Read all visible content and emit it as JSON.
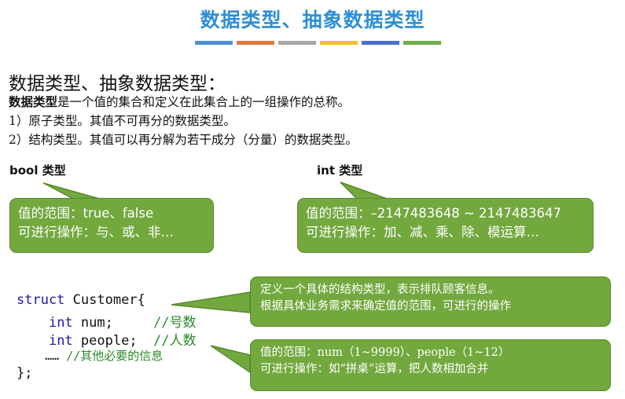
{
  "header": {
    "title": "数据类型、抽象数据类型",
    "bar_colors": [
      "#4e91d4",
      "#e07a3a",
      "#a6a6a6",
      "#f2c12e",
      "#4b6fc9",
      "#6fb04a"
    ]
  },
  "intro": {
    "heading": "数据类型、抽象数据类型：",
    "def_term": "数据类型",
    "def_text": "是一个值的集合和定义在此集合上的一组操作的总称。",
    "item1": "1）原子类型。其值不可再分的数据类型。",
    "item2": "2）结构类型。其值可以再分解为若干成分（分量）的数据类型。"
  },
  "bool_type": {
    "label": "bool 类型",
    "range": "值的范围：true、false",
    "ops": "可进行操作：与、或、非…"
  },
  "int_type": {
    "label": "int 类型",
    "range": "值的范围：–2147483648 ~ 2147483647",
    "ops": "可进行操作：加、减、乘、除、模运算…"
  },
  "code": {
    "kw_struct": "struct",
    "struct_name": " Customer{",
    "kw_int1": "int",
    "field1": " num;     ",
    "comment1": "//号数",
    "kw_int2": "int",
    "field2": " people;  ",
    "comment2": "//人数",
    "ellipsis": "……",
    "comment3": " //其他必要的信息",
    "closing": "};"
  },
  "callout_struct": {
    "line1": "定义一个具体的结构类型，表示排队顾客信息。",
    "line2": "根据具体业务需求来确定值的范围，可进行的操作"
  },
  "callout_values": {
    "line1": "值的范围：num（1~9999）、people（1~12）",
    "line2": "可进行操作：如“拼桌”运算，把人数相加合并"
  },
  "colors": {
    "title": "#2e8fd6",
    "bubble": "#72a83d",
    "keyword": "#1a1aa6",
    "comment": "#2c8a2c"
  }
}
